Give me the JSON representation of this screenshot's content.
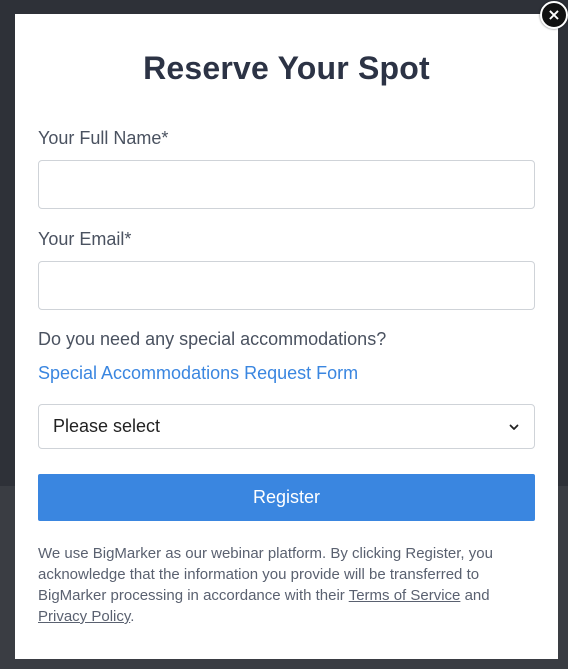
{
  "modal": {
    "title": "Reserve Your Spot",
    "close_label": "×"
  },
  "form": {
    "full_name_label": "Your Full Name*",
    "full_name_value": "",
    "email_label": "Your Email*",
    "email_value": "",
    "accommodations_question": "Do you need any special accommodations?",
    "accommodations_link": "Special Accommodations Request Form",
    "select_value": "Please select",
    "register_label": "Register"
  },
  "disclaimer": {
    "text_before": "We use BigMarker as our webinar platform. By clicking Register, you acknowledge that the information you provide will be transferred to BigMarker processing in accordance with their ",
    "terms_link": "Terms of Service",
    "text_and": " and ",
    "privacy_link": "Privacy Policy",
    "text_after": "."
  },
  "colors": {
    "accent": "#3a86e0",
    "title": "#2c3345",
    "body_text": "#4a5260"
  }
}
